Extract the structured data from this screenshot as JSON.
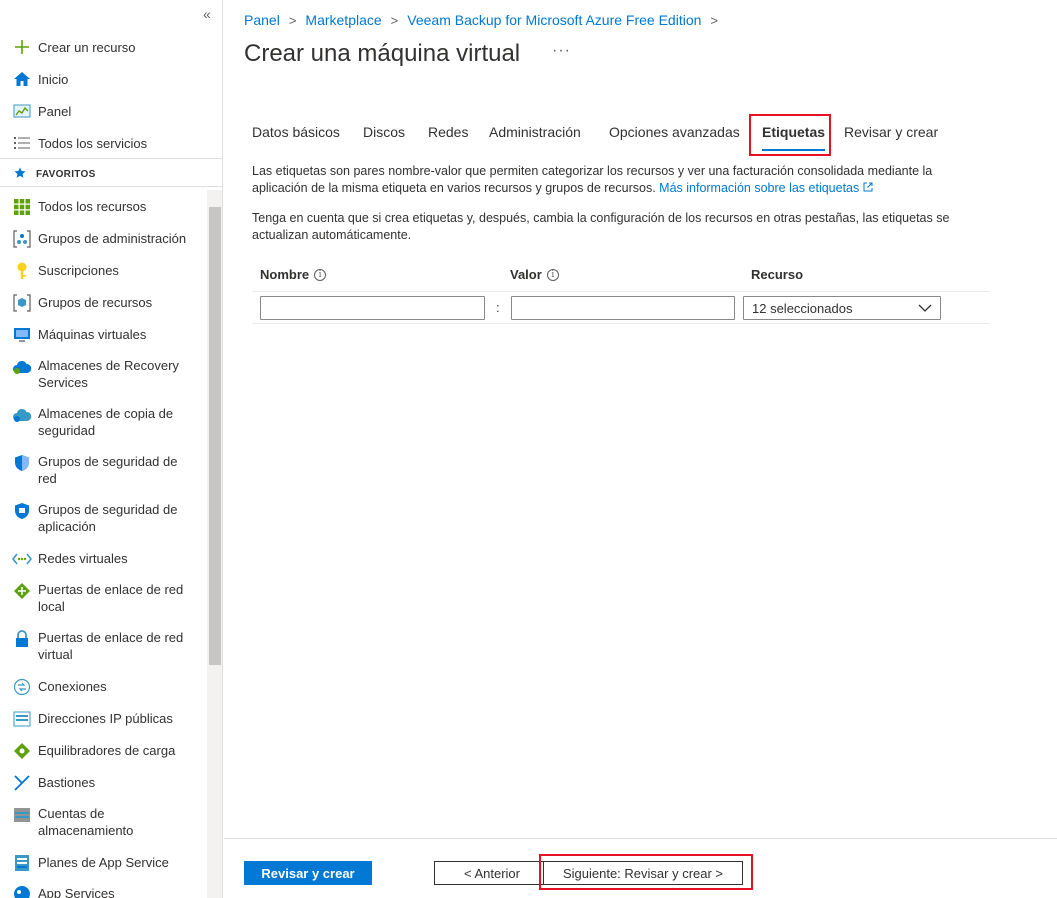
{
  "sidebar": {
    "collapse_icon": "«",
    "create_label": "Crear un recurso",
    "home_label": "Inicio",
    "dashboard_label": "Panel",
    "all_services_label": "Todos los servicios",
    "favorites_header": "FAVORITOS",
    "items": [
      {
        "label": "Todos los recursos",
        "icon": "all-resources-icon",
        "color": "#5ea10d"
      },
      {
        "label": "Grupos de administración",
        "icon": "management-groups-icon",
        "color": "#0078d4"
      },
      {
        "label": "Suscripciones",
        "icon": "key-icon",
        "color": "#fcd116"
      },
      {
        "label": "Grupos de recursos",
        "icon": "resource-groups-icon",
        "color": "#3999c6"
      },
      {
        "label": "Máquinas virtuales",
        "icon": "virtual-machine-icon",
        "color": "#0078d4"
      },
      {
        "label": "Almacenes de Recovery Services",
        "icon": "recovery-vault-icon",
        "color": "#0078d4"
      },
      {
        "label": "Almacenes de copia de seguridad",
        "icon": "backup-vault-icon",
        "color": "#0078d4"
      },
      {
        "label": "Grupos de seguridad de red",
        "icon": "shield-icon",
        "color": "#0078d4"
      },
      {
        "label": "Grupos de seguridad de aplicación",
        "icon": "app-security-shield-icon",
        "color": "#0078d4"
      },
      {
        "label": "Redes virtuales",
        "icon": "virtual-network-icon",
        "color": "#3999c6"
      },
      {
        "label": "Puertas de enlace de red local",
        "icon": "local-gateway-icon",
        "color": "#5ea10d"
      },
      {
        "label": "Puertas de enlace de red virtual",
        "icon": "lock-gateway-icon",
        "color": "#0078d4"
      },
      {
        "label": "Conexiones",
        "icon": "connections-icon",
        "color": "#3999c6"
      },
      {
        "label": "Direcciones IP públicas",
        "icon": "public-ip-icon",
        "color": "#3999c6"
      },
      {
        "label": "Equilibradores de carga",
        "icon": "load-balancer-icon",
        "color": "#5ea10d"
      },
      {
        "label": "Bastiones",
        "icon": "bastion-icon",
        "color": "#0078d4"
      },
      {
        "label": "Cuentas de almacenamiento",
        "icon": "storage-account-icon",
        "color": "#3999c6"
      },
      {
        "label": "Planes de App Service",
        "icon": "app-service-plan-icon",
        "color": "#0078d4"
      },
      {
        "label": "App Services",
        "icon": "app-services-icon",
        "color": "#0078d4"
      }
    ]
  },
  "breadcrumb": [
    "Panel",
    "Marketplace",
    "Veeam Backup for Microsoft Azure Free Edition"
  ],
  "breadcrumb_sep": ">",
  "page_title": "Crear una máquina virtual",
  "more_label": "···",
  "tabs": [
    "Datos básicos",
    "Discos",
    "Redes",
    "Administración",
    "Opciones avanzadas",
    "Etiquetas",
    "Revisar y crear"
  ],
  "active_tab": "Etiquetas",
  "description": {
    "p1": "Las etiquetas son pares nombre-valor que permiten categorizar los recursos y ver una facturación consolidada mediante la aplicación de la misma etiqueta en varios recursos y grupos de recursos.",
    "p1_link": "Más información sobre las etiquetas",
    "p2": "Tenga en cuenta que si crea etiquetas y, después, cambia la configuración de los recursos en otras pestañas, las etiquetas se actualizan automáticamente."
  },
  "tag_table": {
    "col_name": "Nombre",
    "col_value": "Valor",
    "col_resource": "Recurso",
    "info_icon": "i",
    "name_value": "",
    "value_value": "",
    "colon": ":",
    "resource_selected": "12 seleccionados"
  },
  "footer": {
    "review_label": "Revisar y crear",
    "prev_label": "< Anterior",
    "next_label": "Siguiente: Revisar y crear >"
  },
  "colors": {
    "accent": "#0078d4",
    "highlight_border": "#e81123"
  }
}
